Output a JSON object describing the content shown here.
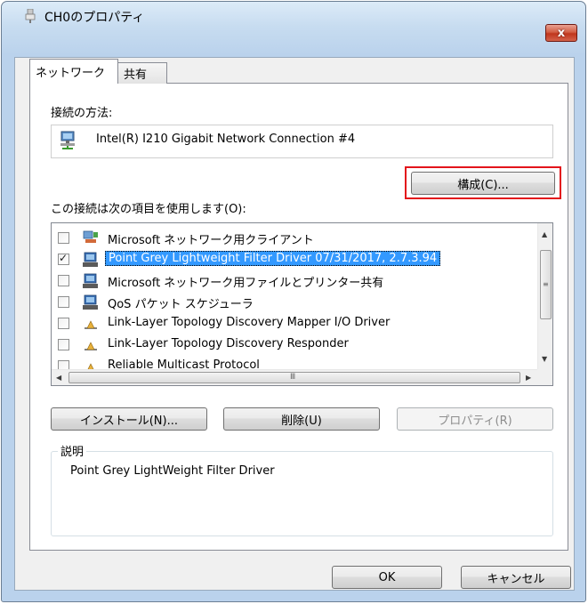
{
  "window": {
    "title": "CH0のプロパティ",
    "close_label": "x"
  },
  "tabs": [
    {
      "label": "ネットワーク",
      "active": true
    },
    {
      "label": "共有",
      "active": false
    }
  ],
  "connect_using": {
    "label": "接続の方法:",
    "adapter": "Intel(R) I210 Gigabit Network Connection #4",
    "configure_label": "構成(C)..."
  },
  "items_section": {
    "label": "この接続は次の項目を使用します(O):",
    "items": [
      {
        "label": "Microsoft ネットワーク用クライアント",
        "checked": false,
        "selected": false,
        "icon": "network-client-icon"
      },
      {
        "label": "Point Grey Lightweight Filter Driver 07/31/2017, 2.7.3.94",
        "checked": true,
        "selected": true,
        "icon": "network-service-icon"
      },
      {
        "label": "Microsoft ネットワーク用ファイルとプリンター共有",
        "checked": false,
        "selected": false,
        "icon": "network-service-icon"
      },
      {
        "label": "QoS パケット スケジューラ",
        "checked": false,
        "selected": false,
        "icon": "network-service-icon"
      },
      {
        "label": "Link-Layer Topology Discovery Mapper I/O Driver",
        "checked": false,
        "selected": false,
        "icon": "protocol-icon"
      },
      {
        "label": "Link-Layer Topology Discovery Responder",
        "checked": false,
        "selected": false,
        "icon": "protocol-icon"
      },
      {
        "label": "Reliable Multicast Protocol",
        "checked": false,
        "selected": false,
        "icon": "protocol-icon"
      }
    ]
  },
  "buttons": {
    "install": "インストール(N)...",
    "uninstall": "削除(U)",
    "properties": "プロパティ(R)",
    "ok": "OK",
    "cancel": "キャンセル"
  },
  "description": {
    "legend": "説明",
    "text": "Point Grey LightWeight Filter Driver"
  },
  "colors": {
    "selection": "#3399ff",
    "highlight_border": "#e3141b"
  }
}
